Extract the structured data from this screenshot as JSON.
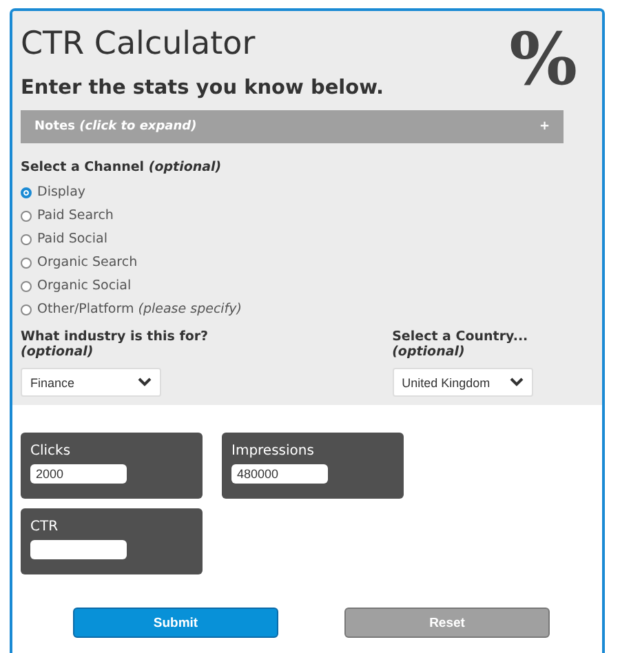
{
  "title": "CTR Calculator",
  "badge_glyph": "%",
  "subtitle": "Enter the stats you know below.",
  "notes": {
    "label": "Notes *(click to expand)*",
    "toggle": "+",
    "expanded": false
  },
  "channel": {
    "label": "Select a Channel *(optional)*",
    "options": [
      {
        "label": "Display",
        "selected": true
      },
      {
        "label": "Paid Search",
        "selected": false
      },
      {
        "label": "Paid Social",
        "selected": false
      },
      {
        "label": "Organic Search",
        "selected": false
      },
      {
        "label": "Organic Social",
        "selected": false
      },
      {
        "label": "Other/Platform *(please specify)*",
        "selected": false
      }
    ]
  },
  "selects": [
    {
      "label": "What industry is this for? *(optional)*",
      "value": "Finance"
    },
    {
      "label": "Select a Country... *(optional)*",
      "value": "United Kingdom"
    }
  ],
  "fields": [
    {
      "label": "Clicks",
      "value": "2000"
    },
    {
      "label": "Impressions",
      "value": "480000"
    },
    {
      "label": "CTR"
    }
  ],
  "buttons": [
    {
      "label": "Submit",
      "kind": "primary"
    },
    {
      "label": "Reset",
      "kind": "secondary"
    }
  ]
}
